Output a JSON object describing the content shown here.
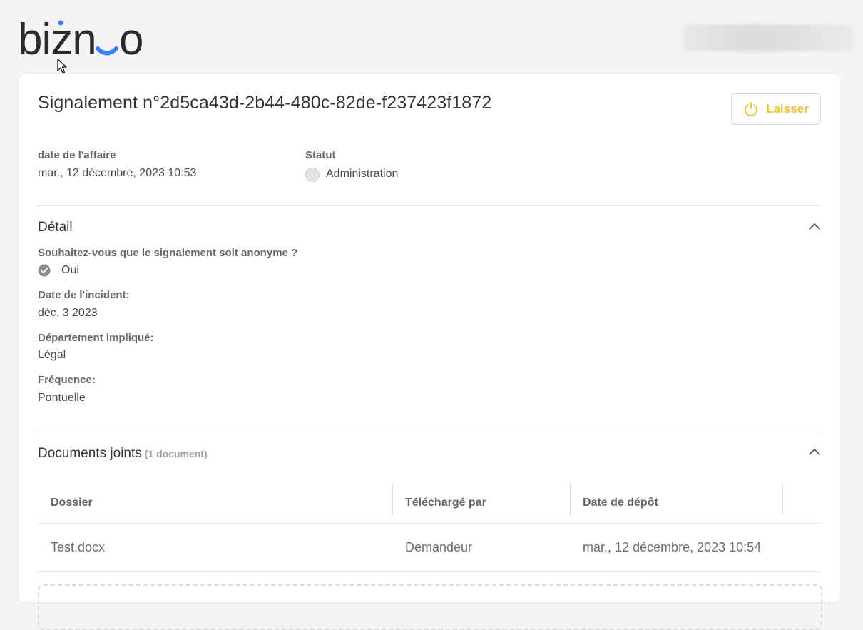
{
  "header": {
    "logo_text": "bizneo",
    "user_name": ""
  },
  "report": {
    "title": "Signalement n°2d5ca43d-2b44-480c-82de-f237423f1872",
    "leave_button_label": "Laisser",
    "date_label": "date de l'affaire",
    "date_value": "mar., 12 décembre, 2023 10:53",
    "status_label": "Statut",
    "status_value": "Administration"
  },
  "detail": {
    "title": "Détail",
    "fields": [
      {
        "label": "Souhaitez-vous que le signalement soit anonyme ?",
        "value": "Oui"
      },
      {
        "label": "Date de l'incident:",
        "value": "déc. 3 2023"
      },
      {
        "label": "Département impliqué:",
        "value": "Légal"
      },
      {
        "label": "Fréquence:",
        "value": "Pontuelle"
      }
    ]
  },
  "documents": {
    "title": "Documents joints",
    "count": "(1 document)",
    "columns": [
      "Dossier",
      "Téléchargé par",
      "Date de dépôt"
    ],
    "rows": [
      {
        "file": "Test.docx",
        "uploaded_by": "Demandeur",
        "date": "mar., 12 décembre, 2023 10:54"
      }
    ]
  },
  "colors": {
    "accent_yellow": "#f2c230",
    "logo_blue": "#3b82f6",
    "logo_dark": "#2b2b2b"
  }
}
